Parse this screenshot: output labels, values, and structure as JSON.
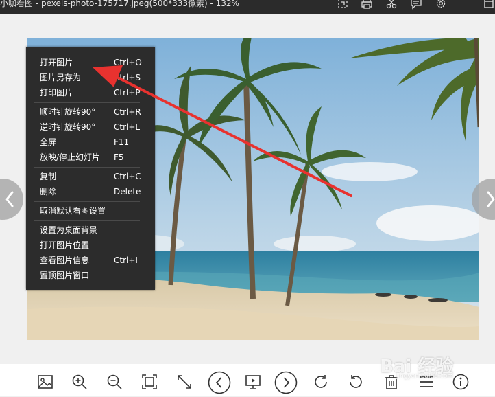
{
  "window": {
    "title": "小咖看图 - pexels-photo-175717.jpeg(500*333像素) - 132%",
    "titlebar_icons": [
      "crop-icon",
      "print-icon",
      "scissors-icon",
      "feedback-icon",
      "gear-icon",
      "window-icon"
    ]
  },
  "context_menu": {
    "groups": [
      [
        {
          "label": "打开图片",
          "shortcut": "Ctrl+O"
        },
        {
          "label": "图片另存为",
          "shortcut": "Ctrl+S"
        },
        {
          "label": "打印图片",
          "shortcut": "Ctrl+P"
        }
      ],
      [
        {
          "label": "顺时针旋转90°",
          "shortcut": "Ctrl+R"
        },
        {
          "label": "逆时针旋转90°",
          "shortcut": "Ctrl+L"
        },
        {
          "label": "全屏",
          "shortcut": "F11"
        },
        {
          "label": "放映/停止幻灯片",
          "shortcut": "F5"
        }
      ],
      [
        {
          "label": "复制",
          "shortcut": "Ctrl+C"
        },
        {
          "label": "删除",
          "shortcut": "Delete"
        }
      ],
      [
        {
          "label": "取消默认看图设置",
          "shortcut": ""
        }
      ],
      [
        {
          "label": "设置为桌面背景",
          "shortcut": ""
        },
        {
          "label": "打开图片位置",
          "shortcut": ""
        },
        {
          "label": "查看图片信息",
          "shortcut": "Ctrl+I"
        },
        {
          "label": "置顶图片窗口",
          "shortcut": ""
        }
      ]
    ]
  },
  "toolbar": {
    "tools": [
      "image-icon",
      "zoom-in-icon",
      "zoom-out-icon",
      "fit-screen-icon",
      "actual-size-icon",
      "previous-icon",
      "slideshow-icon",
      "next-icon",
      "rotate-clockwise-icon",
      "rotate-counterclockwise-icon",
      "delete-icon",
      "menu-icon",
      "info-icon"
    ]
  },
  "colors": {
    "titlebar_bg": "#2b2b2b",
    "menu_bg": "#2c2c2c",
    "annotation": "#e8322f",
    "viewer_bg": "#f0f0f0"
  },
  "watermark": {
    "text": "Bai 经验",
    "sub": "jingyan.baidu.com"
  }
}
